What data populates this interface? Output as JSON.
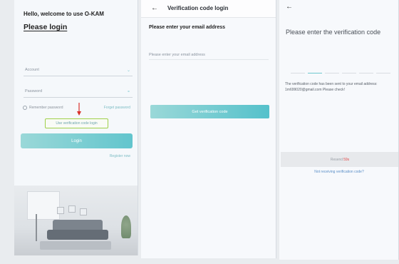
{
  "login": {
    "welcome": "Hello, welcome to use O-KAM",
    "title": "Please login",
    "account_placeholder": "Account",
    "password_placeholder": "Password",
    "remember": "Remember password",
    "forgot": "Forget password",
    "vcode_login": "Use verification code login",
    "login_button": "Login",
    "register": "Register now"
  },
  "email_screen": {
    "title": "Verification code login",
    "prompt": "Please enter your email address",
    "email_placeholder": "Please enter your email address",
    "button": "Get verification code"
  },
  "code_screen": {
    "title": "Please enter the verification code",
    "note": "The verification code has been sent to your email address: 1m699020@gmail.com Please check!",
    "resend_label": "Resend",
    "resend_count": "59s",
    "no_code_link": "Not receiving verification code?"
  },
  "colors": {
    "accent": "#62c5cd",
    "highlight_border": "#9fd04a",
    "arrow": "#d9302a"
  }
}
